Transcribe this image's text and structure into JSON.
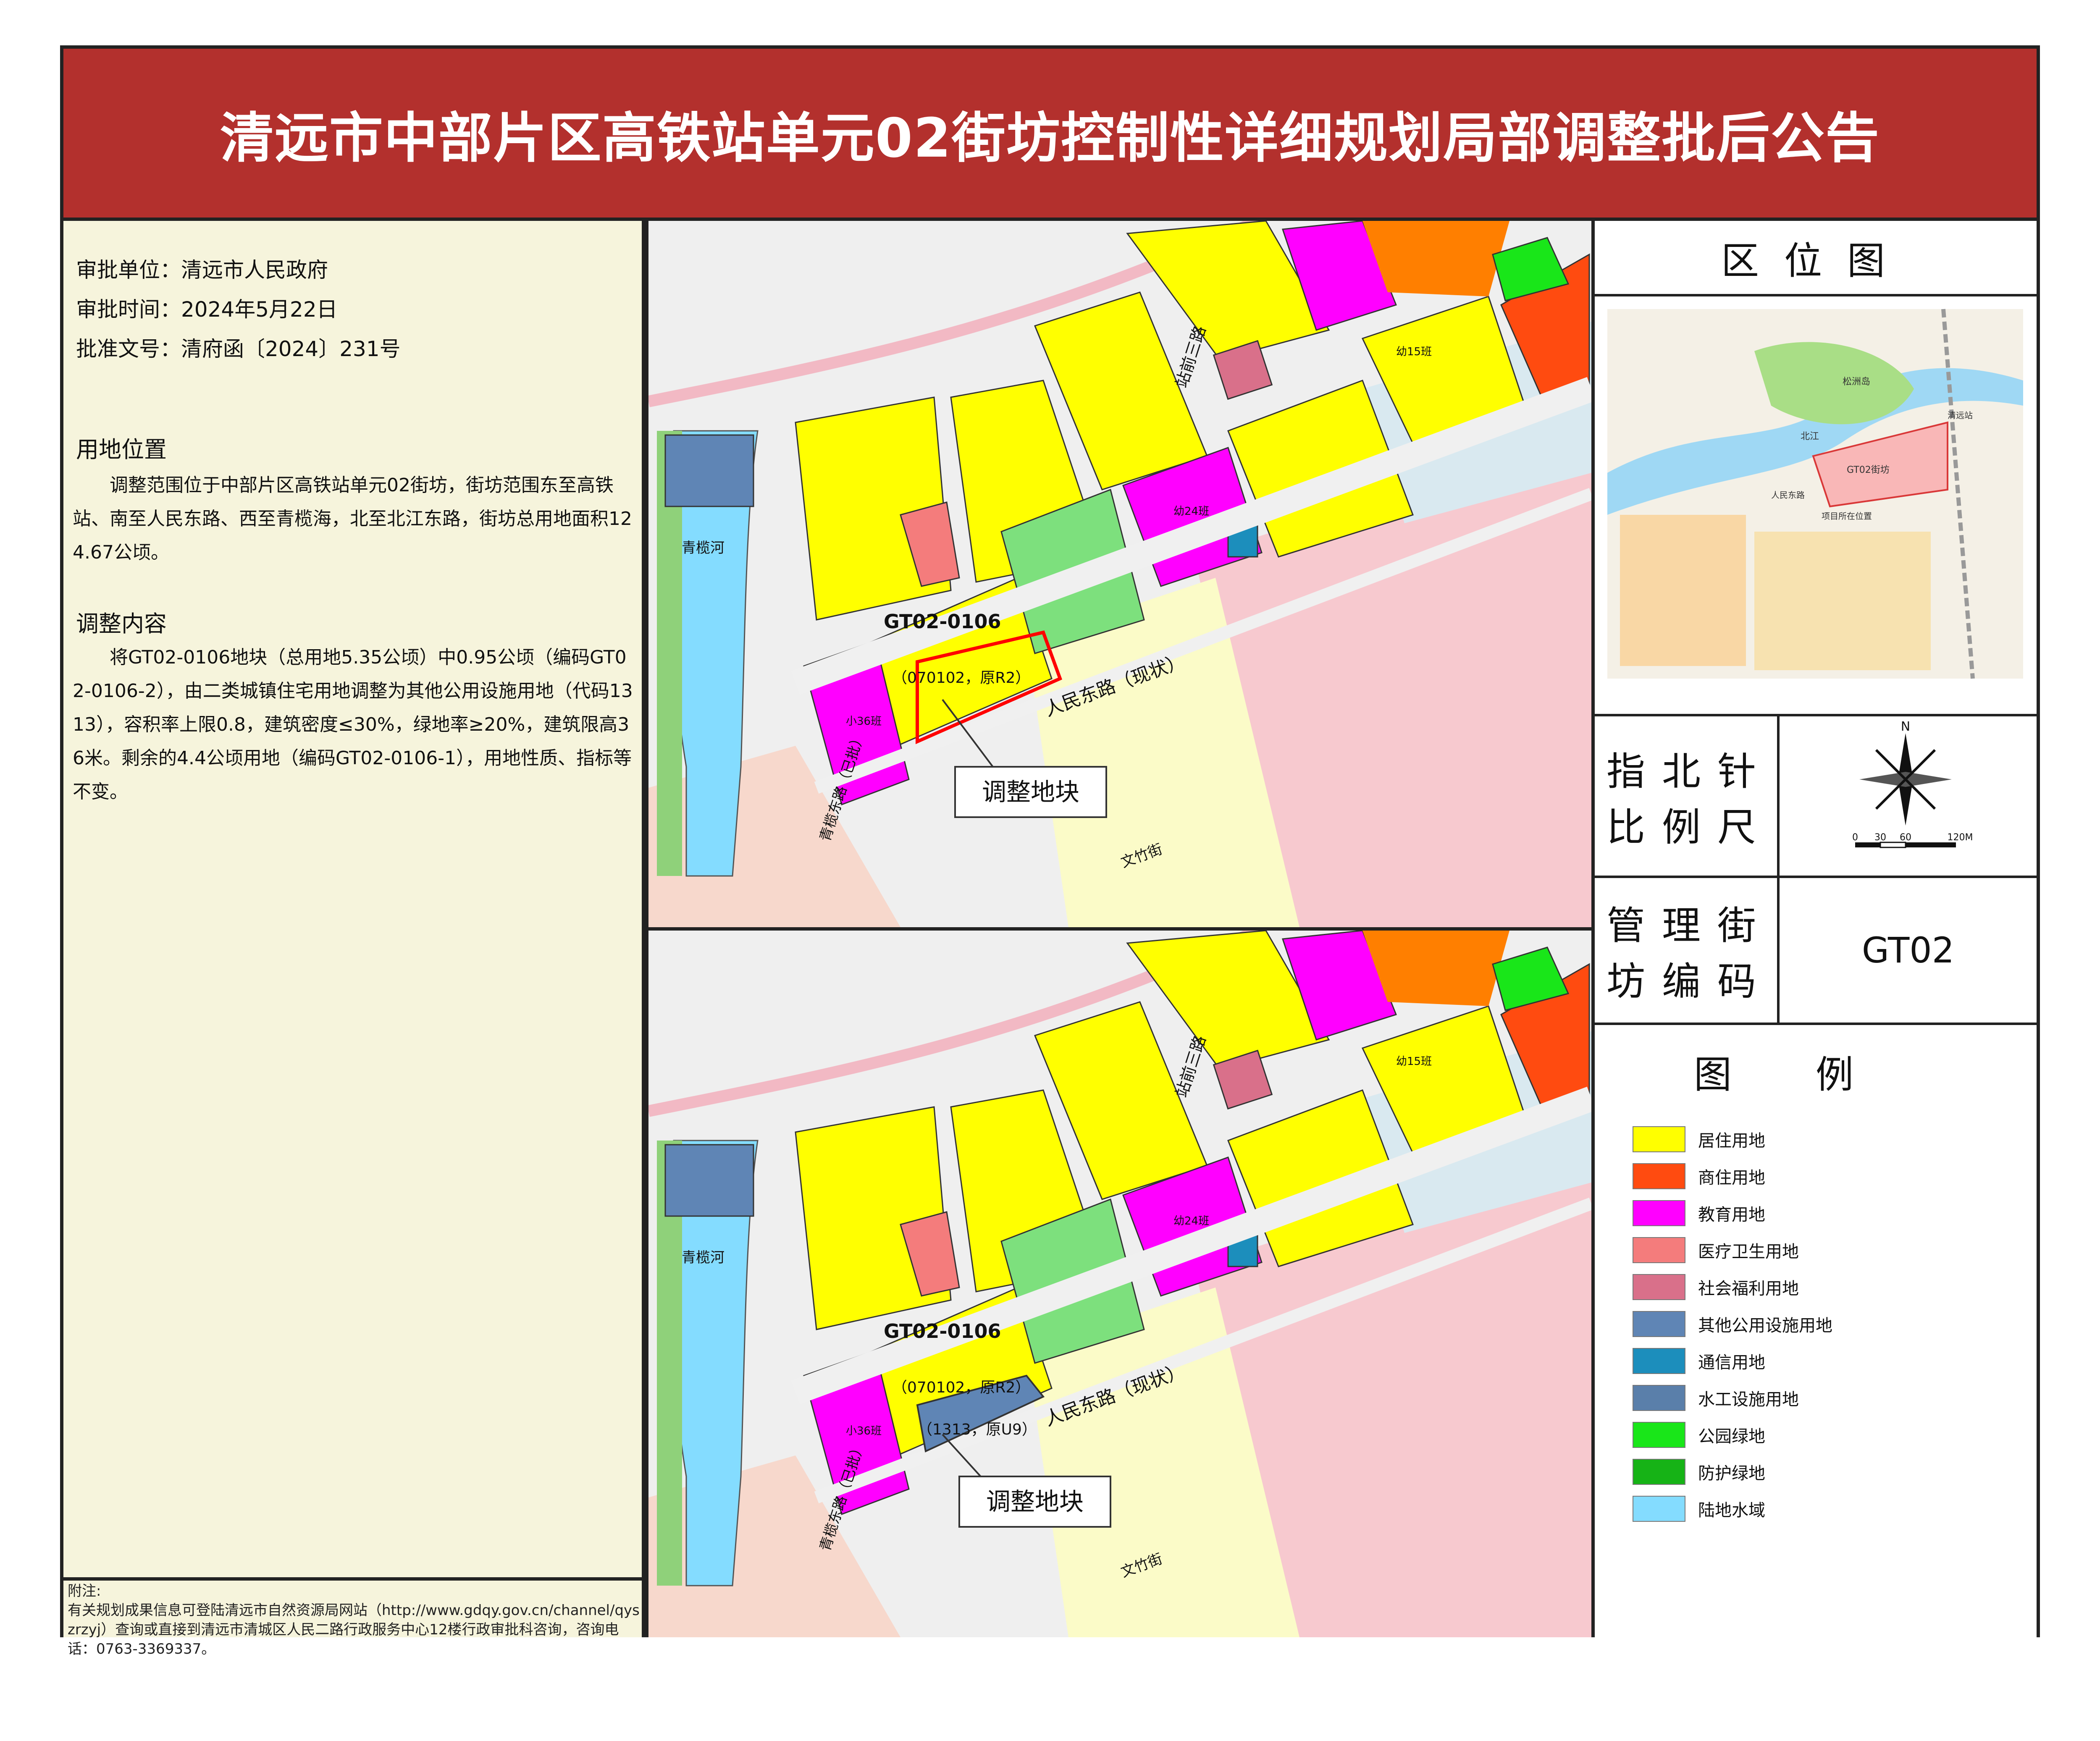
{
  "title": "清远市中部片区高铁站单元02街坊控制性详细规划局部调整批后公告",
  "approval": {
    "unit_label": "审批单位：",
    "unit": "清远市人民政府",
    "time_label": "审批时间：",
    "time": "2024年5月22日",
    "doc_label": "批准文号：",
    "doc": "清府函〔2024〕231号"
  },
  "location": {
    "heading": "用地位置",
    "text": "调整范围位于中部片区高铁站单元02街坊，街坊范围东至高铁站、南至人民东路、西至青榄海，北至北江东路，街坊总用地面积124.67公顷。"
  },
  "adjustment": {
    "heading": "调整内容",
    "text": "将GT02-0106地块（总用地5.35公顷）中0.95公顷（编码GT02-0106-2），由二类城镇住宅用地调整为其他公用设施用地（代码1313），容积率上限0.8，建筑密度≤30%，绿地率≥20%，建筑限高36米。剩余的4.4公顷用地（编码GT02-0106-1），用地性质、指标等不变。"
  },
  "notes": {
    "heading": "附注:",
    "text": "有关规划成果信息可登陆清远市自然资源局网站（http://www.gdqy.gov.cn/channel/qyszrzyj）查询或直接到清远市清城区人民二路行政服务中心12楼行政审批科咨询，咨询电话：0763-3369337。"
  },
  "maps": {
    "top": {
      "parcel_code": "GT02-0106",
      "parcel_original": "（070102，原R2）",
      "callout": "调整地块",
      "road_main": "人民东路（现状）",
      "road_west": "青榄东路（已批）",
      "road_sub3": "站前三路",
      "road_bottom": "文竹街",
      "river": "青榄河",
      "school_label": "小36班",
      "kinder_label": "幼15班",
      "school2_label": "幼24班"
    },
    "bottom": {
      "parcel_code": "GT02-0106",
      "parcel_original": "（070102，原R2）",
      "parcel_new": "（1313，原U9）",
      "callout": "调整地块",
      "road_main": "人民东路（现状）",
      "road_west": "青榄东路（已批）",
      "road_sub3": "站前三路",
      "road_bottom": "文竹街",
      "river": "青榄河",
      "school_label": "小36班",
      "kinder_label": "幼15班",
      "school2_label": "幼24班"
    }
  },
  "location_map": {
    "title": "区位图",
    "labels": [
      "松洲岛",
      "GT02街坊",
      "北江",
      "人民东路",
      "项目所在位置",
      "清远站"
    ]
  },
  "north_scale": {
    "label_line1": "指北针",
    "label_line2": "比例尺",
    "north": "N",
    "scale_ticks": [
      "0",
      "30",
      "60",
      "120M"
    ]
  },
  "block_code": {
    "label_line1": "管理街",
    "label_line2": "坊编码",
    "value": "GT02"
  },
  "legend": {
    "title": "图例",
    "items": [
      {
        "label": "居住用地",
        "color": "#ffff00"
      },
      {
        "label": "商住用地",
        "color": "#ff4b10"
      },
      {
        "label": "教育用地",
        "color": "#ff00ff"
      },
      {
        "label": "医疗卫生用地",
        "color": "#f47c7c"
      },
      {
        "label": "社会福利用地",
        "color": "#d9708a"
      },
      {
        "label": "其他公用设施用地",
        "color": "#5f85b5"
      },
      {
        "label": "通信用地",
        "color": "#1c8ebc"
      },
      {
        "label": "水工设施用地",
        "color": "#5a7faa"
      },
      {
        "label": "公园绿地",
        "color": "#19e619"
      },
      {
        "label": "防护绿地",
        "color": "#16b316"
      },
      {
        "label": "陆地水域",
        "color": "#84dcff"
      }
    ]
  }
}
